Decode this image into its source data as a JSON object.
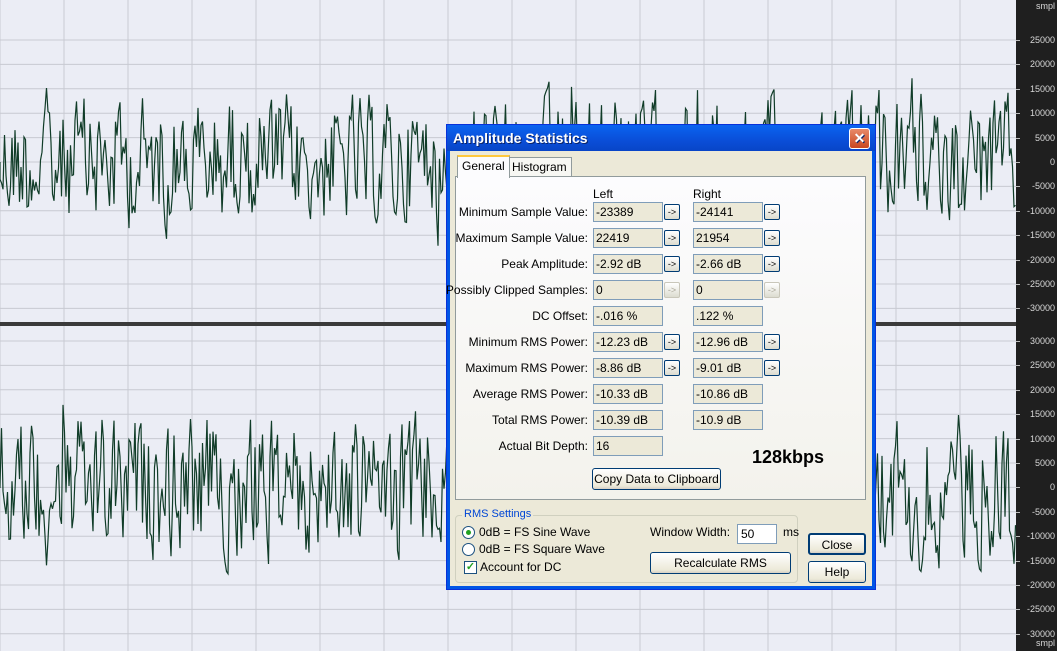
{
  "ruler": {
    "top_unit": "smpl",
    "bottom_unit": "smpl",
    "top_ticks": [
      "25000",
      "20000",
      "15000",
      "10000",
      "5000",
      "0",
      "-5000",
      "-10000",
      "-15000",
      "-20000",
      "-25000",
      "-30000"
    ],
    "bottom_ticks": [
      "30000",
      "25000",
      "20000",
      "15000",
      "10000",
      "5000",
      "0",
      "-5000",
      "-10000",
      "-15000",
      "-20000",
      "-25000",
      "-30000"
    ]
  },
  "colors": {
    "waveform": "#103c28",
    "background": "#ebedf5",
    "grid": "#c8cad2",
    "divider": "#3a3a3a"
  },
  "dialog": {
    "title": "Amplitude Statistics",
    "close_glyph": "✕",
    "tabs": [
      "General",
      "Histogram"
    ],
    "col_left": "Left",
    "col_right": "Right",
    "rows": [
      {
        "label": "Minimum Sample Value:",
        "left": "-23389",
        "right": "-24141"
      },
      {
        "label": "Maximum Sample Value:",
        "left": "22419",
        "right": "21954"
      },
      {
        "label": "Peak Amplitude:",
        "left": "-2.92 dB",
        "right": "-2.66 dB"
      },
      {
        "label": "Possibly Clipped Samples:",
        "left": "0",
        "right": "0"
      },
      {
        "label": "DC Offset:",
        "left": "-.016 %",
        "right": ".122 %"
      },
      {
        "label": "Minimum RMS Power:",
        "left": "-12.23 dB",
        "right": "-12.96 dB"
      },
      {
        "label": "Maximum RMS Power:",
        "left": "-8.86 dB",
        "right": "-9.01 dB"
      },
      {
        "label": "Average RMS Power:",
        "left": "-10.33 dB",
        "right": "-10.86 dB"
      },
      {
        "label": "Total RMS Power:",
        "left": "-10.39 dB",
        "right": "-10.9 dB"
      },
      {
        "label": "Actual Bit Depth:",
        "left": "16",
        "right": ""
      }
    ],
    "arrow_glyph": "->",
    "bitrate": "128kbps",
    "copy_button": "Copy Data to Clipboard",
    "rms_settings": {
      "legend": "RMS Settings",
      "option_sine": "0dB = FS Sine Wave",
      "option_square": "0dB = FS Square Wave",
      "selected": "sine",
      "account_dc": "Account for DC",
      "account_dc_checked": true,
      "check_glyph": "✓",
      "window_width_label": "Window Width:",
      "window_width_value": "50",
      "window_width_unit": "ms",
      "recalc_button": "Recalculate RMS"
    },
    "close_button": "Close",
    "help_button": "Help"
  }
}
